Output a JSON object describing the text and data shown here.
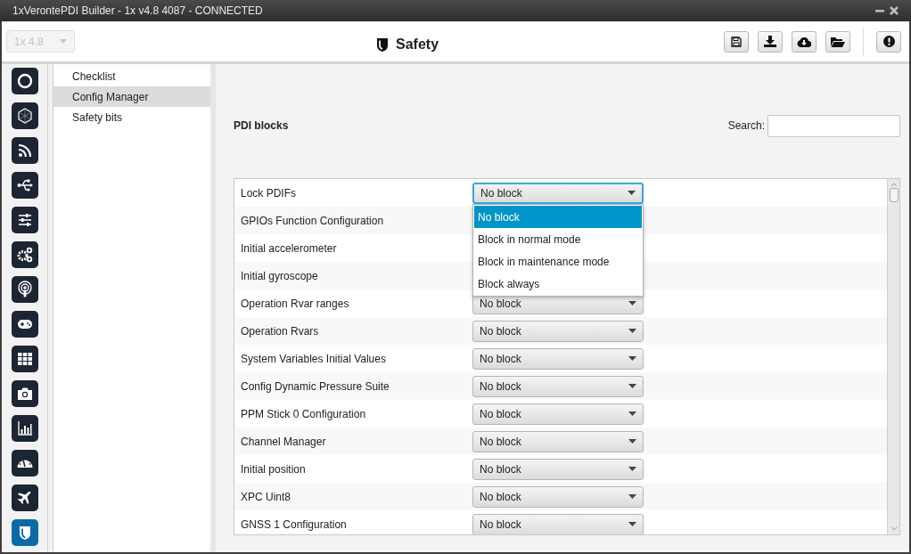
{
  "window": {
    "title": "1xVerontePDI Builder - 1x v4.8 4087 - CONNECTED"
  },
  "toolbar": {
    "version_select": {
      "value": "1x 4.8",
      "disabled": true
    },
    "title": "Safety"
  },
  "nav_rail": [
    {
      "selected": false
    },
    {
      "selected": false
    },
    {
      "selected": false
    },
    {
      "selected": false
    },
    {
      "selected": false
    },
    {
      "selected": false
    },
    {
      "selected": false
    },
    {
      "selected": false
    },
    {
      "selected": false
    },
    {
      "selected": false
    },
    {
      "selected": false
    },
    {
      "selected": false
    },
    {
      "selected": false
    },
    {
      "selected": true
    }
  ],
  "submenu": [
    {
      "label": "Checklist",
      "selected": false
    },
    {
      "label": "Config Manager",
      "selected": true
    },
    {
      "label": "Safety bits",
      "selected": false
    }
  ],
  "section": {
    "title": "PDI blocks",
    "search_label": "Search:"
  },
  "rows": [
    {
      "label": "Lock PDIFs",
      "value": "No block",
      "focused": true
    },
    {
      "label": "GPIOs Function Configuration"
    },
    {
      "label": "Initial accelerometer"
    },
    {
      "label": "Initial gyroscope"
    },
    {
      "label": "Operation Rvar ranges",
      "value": "No block",
      "focused": false
    },
    {
      "label": "Operation Rvars",
      "value": "No block",
      "focused": false
    },
    {
      "label": "System Variables Initial Values",
      "value": "No block",
      "focused": false
    },
    {
      "label": "Config Dynamic Pressure Suite",
      "value": "No block",
      "focused": false
    },
    {
      "label": "PPM Stick 0 Configuration",
      "value": "No block",
      "focused": false
    },
    {
      "label": "Channel Manager",
      "value": "No block",
      "focused": false
    },
    {
      "label": "Initial position",
      "value": "No block",
      "focused": false
    },
    {
      "label": "XPC Uint8",
      "value": "No block",
      "focused": false
    },
    {
      "label": "GNSS 1 Configuration",
      "value": "No block",
      "focused": false
    }
  ],
  "dropdown": {
    "options": [
      {
        "label": "No block",
        "selected": true
      },
      {
        "label": "Block in normal mode",
        "selected": false
      },
      {
        "label": "Block in maintenance mode",
        "selected": false
      },
      {
        "label": "Block always",
        "selected": false
      }
    ]
  }
}
